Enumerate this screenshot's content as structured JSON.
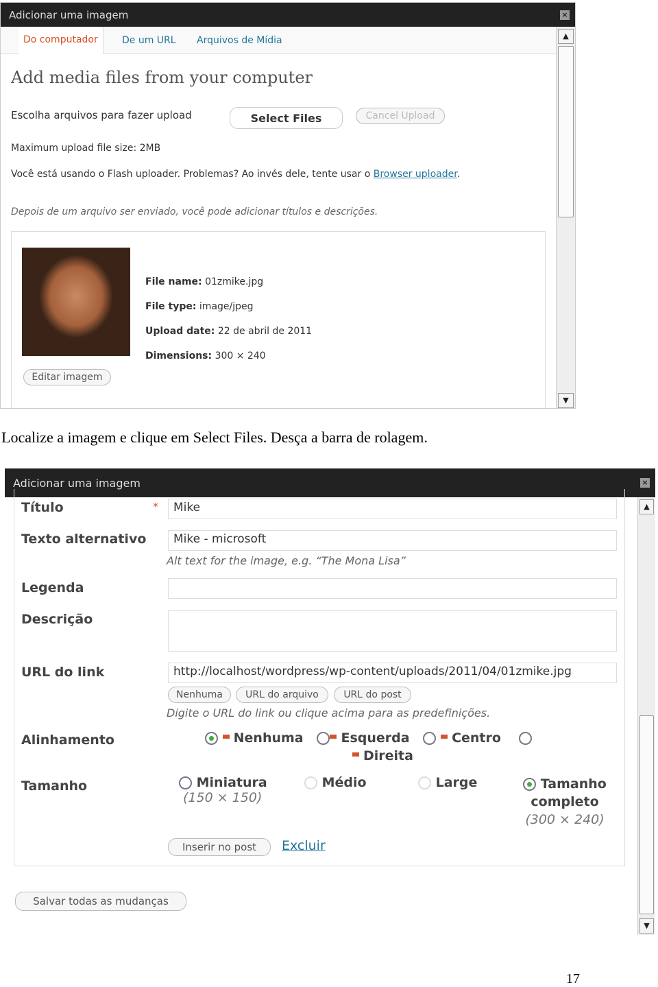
{
  "shot1": {
    "title": "Adicionar uma imagem",
    "tabs": [
      "Do computador",
      "De um URL",
      "Arquivos de Mídia"
    ],
    "heading": "Add media files from your computer",
    "choose_label": "Escolha arquivos para fazer upload",
    "select_files": "Select Files",
    "cancel_upload": "Cancel Upload",
    "max_size": "Maximum upload file size: 2MB",
    "flash_text": "Você está usando o Flash uploader. Problemas? Ao invés dele, tente usar o ",
    "browser_link": "Browser uploader",
    "after_text": "Depois de um arquivo ser enviado, você pode adicionar títulos e descrições.",
    "file": {
      "name_label": "File name:",
      "name": "01zmike.jpg",
      "type_label": "File type:",
      "type": "image/jpeg",
      "date_label": "Upload date:",
      "date": "22 de abril de 2011",
      "dim_label": "Dimensions:",
      "dim": "300 × 240"
    },
    "edit_image": "Editar imagem"
  },
  "caption": "Localize a imagem e clique em Select Files. Desça a barra de rolagem.",
  "shot2": {
    "title": "Adicionar uma imagem",
    "titulo_label": "Título",
    "required": "*",
    "titulo_value": "Mike",
    "alt_label": "Texto alternativo",
    "alt_value": "Mike - microsoft",
    "alt_help": "Alt text for the image, e.g. “The Mona Lisa”",
    "legenda_label": "Legenda",
    "legenda_value": "",
    "descricao_label": "Descrição",
    "descricao_value": "",
    "url_label": "URL do link",
    "url_value": "http://localhost/wordpress/wp-content/uploads/2011/04/01zmike.jpg",
    "url_buttons": [
      "Nenhuma",
      "URL do arquivo",
      "URL do post"
    ],
    "url_help": "Digite o URL do link ou clique acima para as predefinições.",
    "align_label": "Alinhamento",
    "align_options": [
      "Nenhuma",
      "Esquerda",
      "Centro",
      "Direita"
    ],
    "align_selected": "Nenhuma",
    "size_label": "Tamanho",
    "sizes": [
      {
        "name": "Miniatura",
        "dim": "(150 × 150)"
      },
      {
        "name": "Médio",
        "dim": ""
      },
      {
        "name": "Large",
        "dim": ""
      },
      {
        "name": "Tamanho completo",
        "dim": "(300 × 240)"
      }
    ],
    "size_selected": "Tamanho completo",
    "insert": "Inserir no post",
    "delete": "Excluir",
    "save_all": "Salvar todas as mudanças"
  },
  "page_number": "17"
}
